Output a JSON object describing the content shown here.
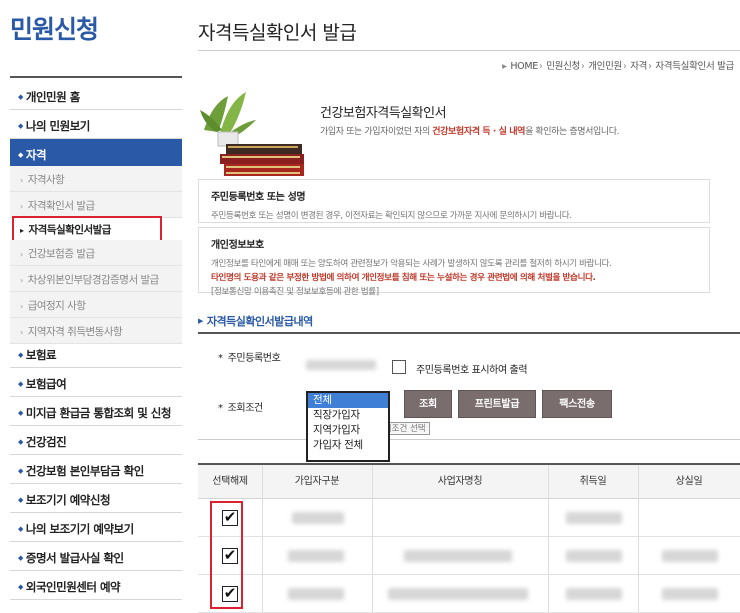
{
  "sidebar": {
    "title": "민원신청",
    "items": [
      {
        "label": "개인민원 홈"
      },
      {
        "label": "나의 민원보기"
      },
      {
        "label": "자격"
      },
      {
        "label": "보험료"
      },
      {
        "label": "보험급여"
      },
      {
        "label": "미지급 환급금 통합조회 및 신청"
      },
      {
        "label": "건강검진"
      },
      {
        "label": "건강보험 본인부담금 확인"
      },
      {
        "label": "보조기기 예약신청"
      },
      {
        "label": "나의 보조기기 예약보기"
      },
      {
        "label": "증명서 발급사실 확인"
      },
      {
        "label": "외국인민원센터 예약"
      }
    ],
    "sub_items": [
      {
        "label": "자격사항"
      },
      {
        "label": "자격확인서 발급"
      },
      {
        "label": "자격득실확인서발급"
      },
      {
        "label": "건강보험증 발급"
      },
      {
        "label": "차상위본인부담경감증명서 발급"
      },
      {
        "label": "급여정지 사항"
      },
      {
        "label": "지역자격 취득변동사항"
      }
    ]
  },
  "header": {
    "title": "자격득실확인서 발급",
    "breadcrumb": [
      "HOME",
      "민원신청",
      "개인민원",
      "자격",
      "자격득실확인서 발급"
    ]
  },
  "doc_info": {
    "title": "건강보험자격득실확인서",
    "desc_before": "가입자 또는 가입자이었던 자의 ",
    "desc_highlight": "건강보험자격 득 · 실 내역",
    "desc_after": "을 확인하는 증명서입니다."
  },
  "notice1": {
    "title": "주민등록번호 또는 성명",
    "text": "주민등록번호 또는 성명이 변경된 경우, 이전자료는 확인되지 않으므로 가까운 지사에 문의하시기 바랍니다."
  },
  "notice2": {
    "title": "개인정보보호",
    "line1": "개인정보를 타인에게 매매 또는 양도하여 관련정보가 악용되는 사례가 발생하지 않도록 관리를 철저히 하시기 바랍니다.",
    "line2": "타인명의 도용과 같은 부정한 방법에 의하여 개인정보를 침해 또는 누설하는 경우 관련법에 의해 처벌을 받습니다.",
    "line3": "[정보통신망 이용촉진 및 정보보호등에 관한 법률]"
  },
  "section_title": "자격득실확인서발급내역",
  "form": {
    "rrn_label": "주민등록번호",
    "rrn_check_label": "주민등록번호 표시하여 출력",
    "rrn_checked": false,
    "cond_label": "조회조건",
    "options": [
      "전체",
      "직장가입자",
      "지역가입자",
      "가입자 전체"
    ],
    "selected_option": "전체",
    "tooltip": "조회조건 선택",
    "btn_search": "조회",
    "btn_print": "프린트발급",
    "btn_fax": "팩스전송"
  },
  "table": {
    "headers": [
      "선택해제",
      "가입자구분",
      "사업자명칭",
      "취득일",
      "상실일"
    ],
    "rows": [
      {
        "checked": true
      },
      {
        "checked": true
      },
      {
        "checked": true
      }
    ],
    "check_mark": "✔"
  },
  "colors": {
    "brand": "#2a5aa7",
    "highlight": "#d9232e",
    "button": "#7a6d6d"
  }
}
